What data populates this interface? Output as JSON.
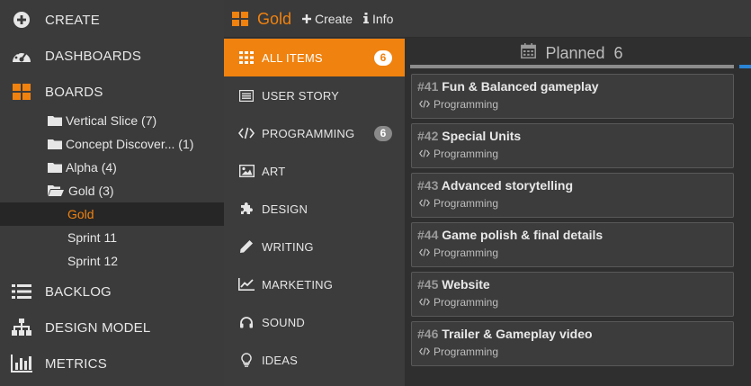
{
  "leftnav": {
    "create": "CREATE",
    "dashboards": "DASHBOARDS",
    "boards": "BOARDS",
    "board_items": [
      {
        "label": "Vertical Slice (7)",
        "type": "folder"
      },
      {
        "label": "Concept Discover... (1)",
        "type": "folder"
      },
      {
        "label": "Alpha (4)",
        "type": "folder"
      },
      {
        "label": "Gold (3)",
        "type": "folder-open"
      },
      {
        "label": "Gold",
        "type": "board"
      },
      {
        "label": "Sprint 11",
        "type": "board"
      },
      {
        "label": "Sprint 12",
        "type": "board"
      }
    ],
    "backlog": "BACKLOG",
    "design_model": "DESIGN MODEL",
    "metrics": "METRICS"
  },
  "header": {
    "title": "Gold",
    "create_label": "Create",
    "info_label": "Info"
  },
  "categories": [
    {
      "label": "ALL ITEMS",
      "icon": "grid-icon",
      "badge": "6"
    },
    {
      "label": "USER STORY",
      "icon": "user-story-icon",
      "badge": ""
    },
    {
      "label": "PROGRAMMING",
      "icon": "code-icon",
      "badge": "6"
    },
    {
      "label": "ART",
      "icon": "image-icon",
      "badge": ""
    },
    {
      "label": "DESIGN",
      "icon": "puzzle-icon",
      "badge": ""
    },
    {
      "label": "WRITING",
      "icon": "pencil-icon",
      "badge": ""
    },
    {
      "label": "MARKETING",
      "icon": "chart-line-icon",
      "badge": ""
    },
    {
      "label": "SOUND",
      "icon": "headphones-icon",
      "badge": ""
    },
    {
      "label": "IDEAS",
      "icon": "lightbulb-icon",
      "badge": ""
    }
  ],
  "column": {
    "name": "Planned",
    "count": "6"
  },
  "cards": [
    {
      "num": "#41",
      "title": "Fun & Balanced gameplay",
      "tag": "Programming"
    },
    {
      "num": "#42",
      "title": "Special Units",
      "tag": "Programming"
    },
    {
      "num": "#43",
      "title": "Advanced storytelling",
      "tag": "Programming"
    },
    {
      "num": "#44",
      "title": "Game polish & final details",
      "tag": "Programming"
    },
    {
      "num": "#45",
      "title": "Website",
      "tag": "Programming"
    },
    {
      "num": "#46",
      "title": "Trailer & Gameplay video",
      "tag": "Programming"
    }
  ],
  "colors": {
    "accent": "#f0820f",
    "nav_bg": "#3b3b3b",
    "selected_bg": "#262626",
    "column_bar": "#8c8c8c",
    "next_column_bar": "#2a84d6"
  }
}
